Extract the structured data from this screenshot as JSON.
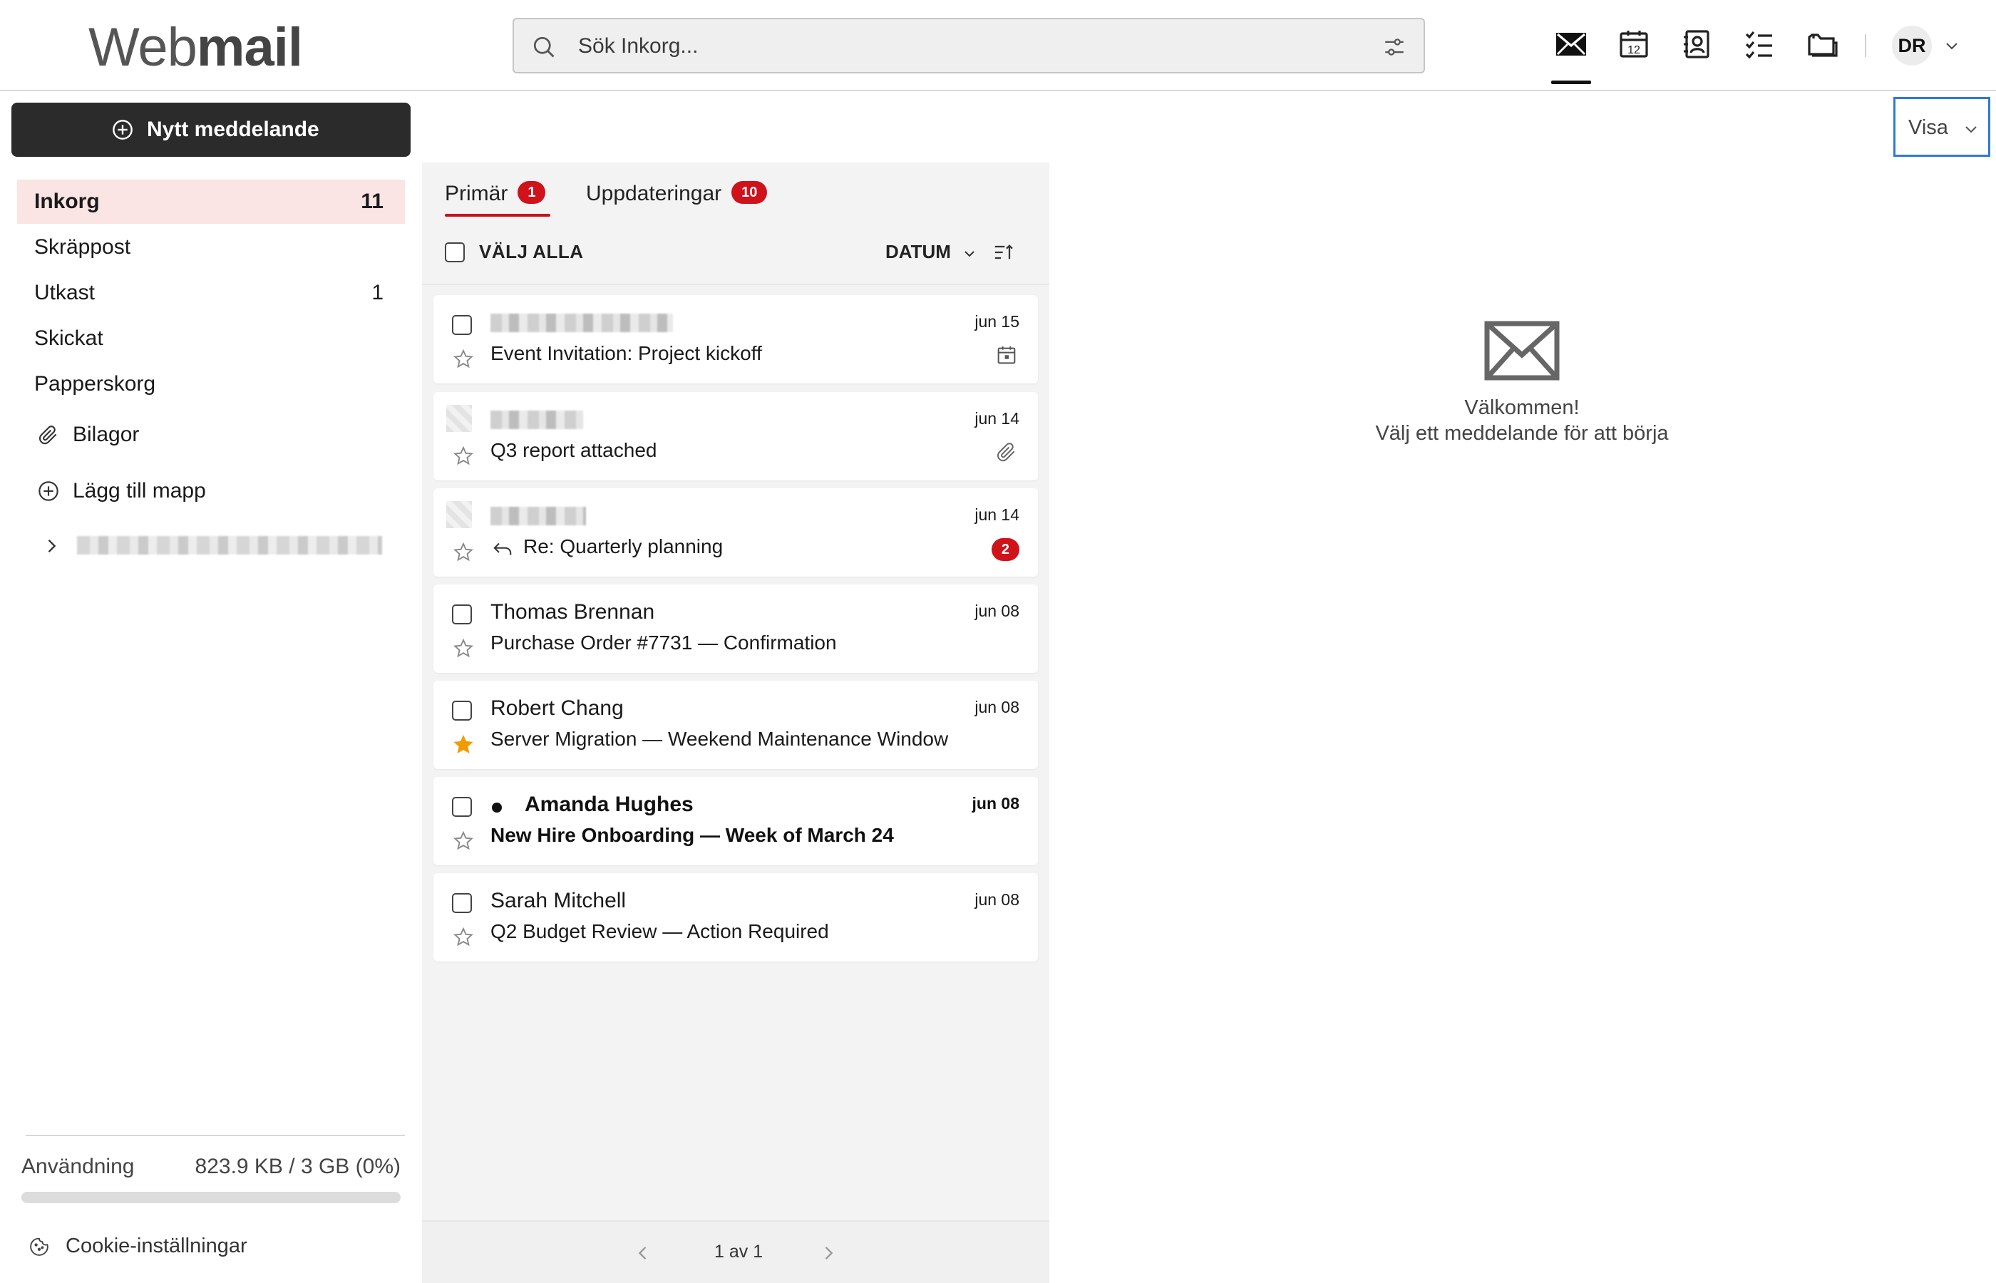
{
  "app": {
    "logo_light": "Web",
    "logo_bold": "mail"
  },
  "search": {
    "placeholder": "Sök Inkorg..."
  },
  "header": {
    "apps": [
      {
        "icon": "mail-icon",
        "active": true
      },
      {
        "icon": "calendar-icon",
        "label": "12"
      },
      {
        "icon": "contacts-icon"
      },
      {
        "icon": "tasks-icon"
      },
      {
        "icon": "files-icon"
      }
    ],
    "user_initials": "DR"
  },
  "sidebar": {
    "compose_label": "Nytt meddelande",
    "folders": [
      {
        "label": "Inkorg",
        "count": "11",
        "active": true
      },
      {
        "label": "Skräppost",
        "count": ""
      },
      {
        "label": "Utkast",
        "count": "1"
      },
      {
        "label": "Skickat",
        "count": ""
      },
      {
        "label": "Papperskorg",
        "count": ""
      }
    ],
    "attachments_label": "Bilagor",
    "add_folder_label": "Lägg till mapp",
    "usage_label": "Användning",
    "usage_value": "823.9 KB / 3 GB (0%)",
    "usage_percent": 0,
    "cookie_label": "Cookie-inställningar"
  },
  "list": {
    "tabs": [
      {
        "label": "Primär",
        "badge": "1",
        "active": true
      },
      {
        "label": "Uppdateringar",
        "badge": "10",
        "active": false
      }
    ],
    "select_all_label": "VÄLJ ALLA",
    "sort_label": "DATUM",
    "messages": [
      {
        "sender": "",
        "subject": "Event Invitation: Project kickoff",
        "date": "jun 15",
        "starred": false,
        "unread": false,
        "meta": "calendar-icon"
      },
      {
        "sender": "",
        "subject": "Q3 report attached",
        "date": "jun 14",
        "starred": false,
        "unread": false,
        "meta": "paperclip-icon"
      },
      {
        "sender": "",
        "subject": "Re: Quarterly planning",
        "date": "jun 14",
        "starred": false,
        "unread": false,
        "thread_count": "2",
        "replied": true
      },
      {
        "sender": "Thomas Brennan",
        "subject": "Purchase Order #7731 — Confirmation",
        "date": "jun 08",
        "starred": false,
        "unread": false
      },
      {
        "sender": "Robert Chang",
        "subject": "Server Migration — Weekend Maintenance Window",
        "date": "jun 08",
        "starred": true,
        "unread": false
      },
      {
        "sender": "Amanda Hughes",
        "subject": "New Hire Onboarding — Week of March 24",
        "date": "jun 08",
        "starred": false,
        "unread": true
      },
      {
        "sender": "Sarah Mitchell",
        "subject": "Q2 Budget Review — Action Required",
        "date": "jun 08",
        "starred": false,
        "unread": false
      }
    ],
    "pager_text": "1 av 1"
  },
  "reading": {
    "view_label": "Visa",
    "welcome_title": "Välkommen!",
    "welcome_sub": "Välj ett meddelande för att börja"
  },
  "colors": {
    "accent_red": "#d0121b",
    "star_orange": "#f29b00",
    "focus_blue": "#2d7ad8",
    "compose_bg": "#2b2b2b"
  }
}
